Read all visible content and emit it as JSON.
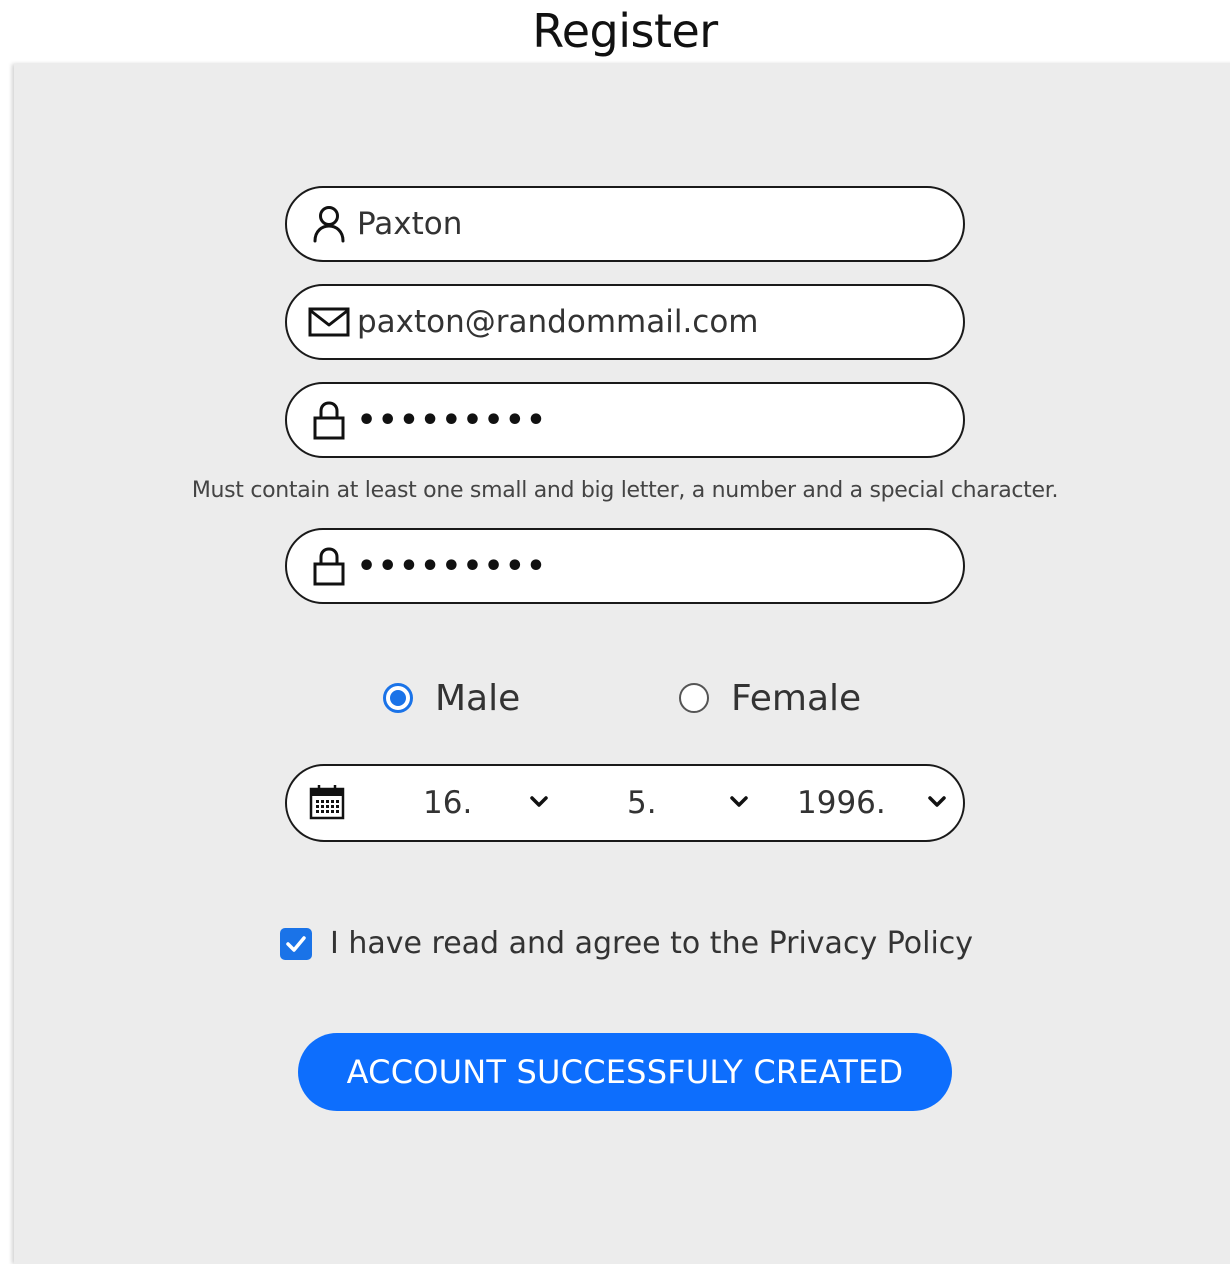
{
  "page": {
    "title": "Register"
  },
  "form": {
    "name": {
      "value": "Paxton",
      "icon": "user-icon"
    },
    "email": {
      "value": "paxton@randommail.com",
      "icon": "envelope-icon"
    },
    "password": {
      "value": "•••••••••",
      "icon": "lock-icon"
    },
    "password_hint": "Must contain at least one small and big letter, a number and a special character.",
    "confirm_password": {
      "value": "•••••••••",
      "icon": "lock-icon"
    },
    "gender": {
      "options": [
        {
          "label": "Male",
          "selected": true
        },
        {
          "label": "Female",
          "selected": false
        }
      ]
    },
    "birthdate": {
      "icon": "calendar-icon",
      "day": "16.",
      "month": "5.",
      "year": "1996."
    },
    "consent": {
      "label": "I have read and agree to the Privacy Policy",
      "checked": true
    },
    "submit_label": "ACCOUNT SUCCESSFULY CREATED"
  },
  "colors": {
    "accent": "#0d6efd",
    "panel_bg": "#ececec"
  }
}
